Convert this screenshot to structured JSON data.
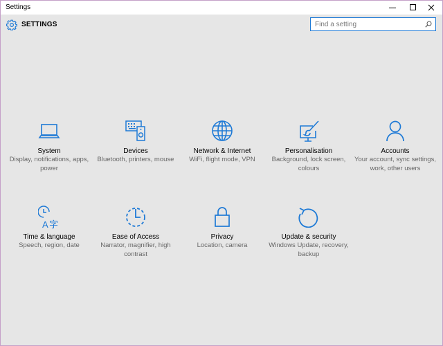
{
  "window": {
    "title": "Settings"
  },
  "header": {
    "title": "SETTINGS"
  },
  "search": {
    "placeholder": "Find a setting"
  },
  "tiles": [
    {
      "label": "System",
      "description": "Display, notifications, apps, power",
      "icon": "laptop-icon"
    },
    {
      "label": "Devices",
      "description": "Bluetooth, printers, mouse",
      "icon": "devices-icon"
    },
    {
      "label": "Network & Internet",
      "description": "WiFi, flight mode, VPN",
      "icon": "globe-icon"
    },
    {
      "label": "Personalisation",
      "description": "Background, lock screen, colours",
      "icon": "paintbrush-icon"
    },
    {
      "label": "Accounts",
      "description": "Your account, sync settings, work, other users",
      "icon": "person-icon"
    },
    {
      "label": "Time & language",
      "description": "Speech, region, date",
      "icon": "clock-language-icon"
    },
    {
      "label": "Ease of Access",
      "description": "Narrator, magnifier, high contrast",
      "icon": "ease-of-access-icon"
    },
    {
      "label": "Privacy",
      "description": "Location, camera",
      "icon": "lock-icon"
    },
    {
      "label": "Update & security",
      "description": "Windows Update, recovery, backup",
      "icon": "refresh-icon"
    }
  ],
  "colors": {
    "accent": "#1e7ad6",
    "background": "#e6e6e6",
    "text": "#000000",
    "subtext": "#666666"
  }
}
